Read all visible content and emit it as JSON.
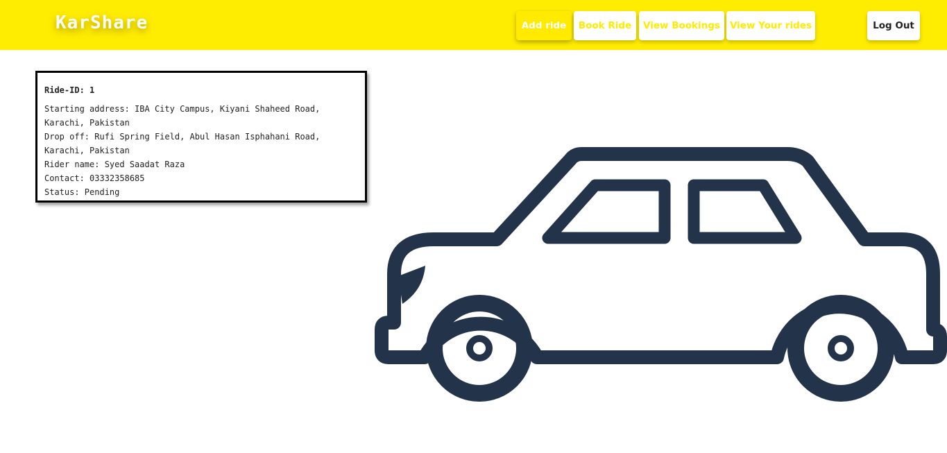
{
  "navbar": {
    "brand": "KarShare",
    "buttons": [
      {
        "label": "Add ride"
      },
      {
        "label": "Book Ride"
      },
      {
        "label": "View Bookings"
      },
      {
        "label": "View Your rides"
      }
    ],
    "logout_label": "Log Out"
  },
  "ride": {
    "id_line": "Ride-ID: 1",
    "starting_line": "Starting address: IBA City Campus, Kiyani Shaheed Road, Karachi, Pakistan",
    "dropoff_line": "Drop off: Rufi Spring Field, Abul Hasan Isphahani Road, Karachi, Pakistan",
    "rider_line": "Rider name: Syed Saadat Raza",
    "contact_line": "Contact: 03332358685",
    "status_line": "Status: Pending"
  },
  "colors": {
    "navbar_bg": "#ffed00",
    "accent": "#ffea00",
    "car_stroke": "#22334a"
  },
  "icons": {
    "hero": "car-icon"
  }
}
